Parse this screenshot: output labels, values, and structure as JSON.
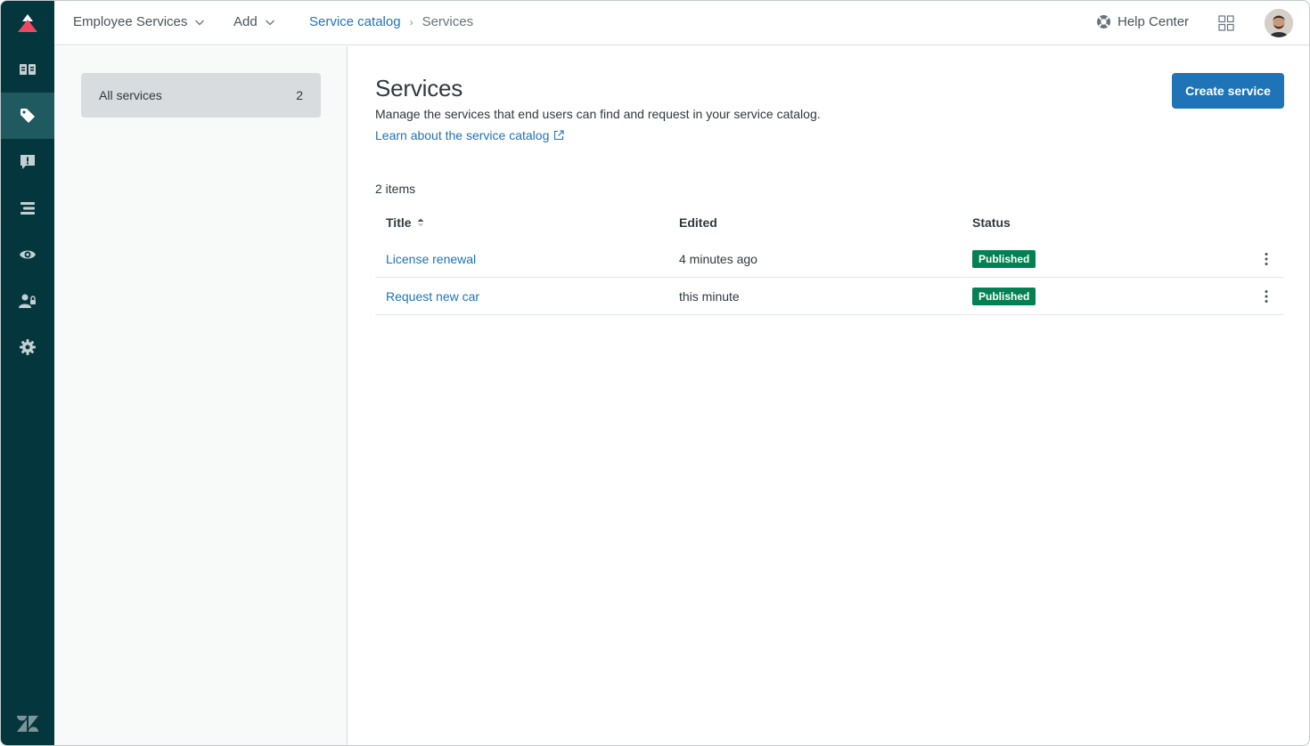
{
  "topbar": {
    "brand_label": "Employee Services",
    "add_label": "Add",
    "breadcrumb": {
      "parent": "Service catalog",
      "current": "Services"
    },
    "help_center_label": "Help Center"
  },
  "rail": {
    "items": [
      {
        "icon": "knowledge-icon"
      },
      {
        "icon": "tag-icon",
        "active": true
      },
      {
        "icon": "feedback-icon"
      },
      {
        "icon": "arrange-content-icon"
      },
      {
        "icon": "preview-icon"
      },
      {
        "icon": "user-permissions-icon"
      },
      {
        "icon": "settings-icon"
      }
    ]
  },
  "subnav": {
    "items": [
      {
        "label": "All services",
        "count": "2"
      }
    ]
  },
  "main": {
    "title": "Services",
    "description": "Manage the services that end users can find and request in your service catalog.",
    "learn_link": "Learn about the service catalog",
    "create_button": "Create service",
    "item_count": "2 items",
    "columns": {
      "title": "Title",
      "edited": "Edited",
      "status": "Status"
    },
    "rows": [
      {
        "title": "License renewal",
        "edited": "4 minutes ago",
        "status": "Published"
      },
      {
        "title": "Request new car",
        "edited": "this minute",
        "status": "Published"
      }
    ]
  },
  "colors": {
    "rail_bg": "#03363d",
    "rail_active": "#1f5a60",
    "link": "#1f73b7",
    "primary_button": "#1f73b7",
    "published_badge": "#038153",
    "logo_accent": "#eb4962"
  }
}
